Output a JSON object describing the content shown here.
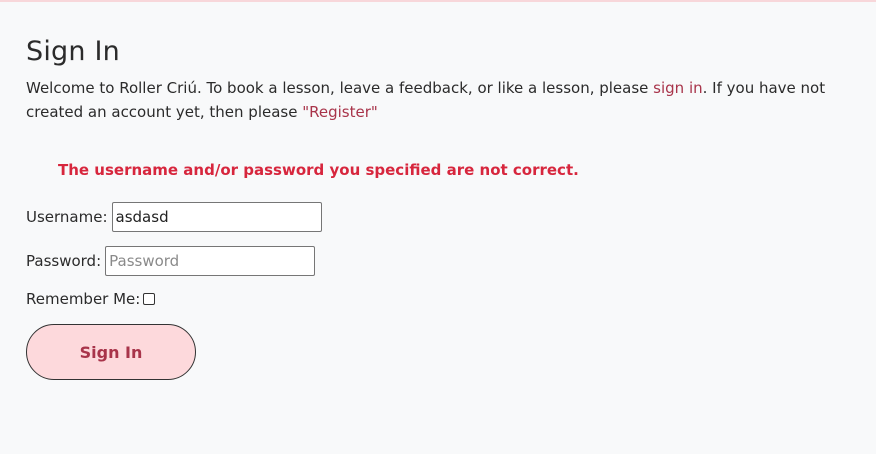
{
  "page": {
    "title": "Sign In",
    "intro_before_link": "Welcome to Roller Criú. To book a lesson, leave a feedback, or like a lesson, please ",
    "intro_link": "sign in",
    "intro_between": ". If you have not created an account yet, then please ",
    "register_link": "\"Register\"",
    "error_message": "The username and/or password you specified are not correct."
  },
  "form": {
    "username_label": "Username:",
    "username_value": "asdasd",
    "password_label": "Password:",
    "password_placeholder": "Password",
    "remember_label": "Remember Me:",
    "remember_checked": false,
    "submit_label": "Sign In"
  },
  "colors": {
    "background": "#f8f9fa",
    "link": "#a8344a",
    "error": "#d7263d",
    "button_bg": "#fdd9dc",
    "button_text": "#a8344a"
  }
}
